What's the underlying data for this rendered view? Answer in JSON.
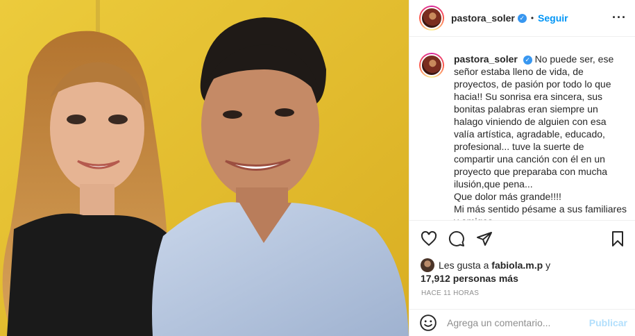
{
  "post": {
    "username": "pastora_soler",
    "separator": "•",
    "follow_label": "Seguir",
    "more_icon": "more-horizontal-icon",
    "verified_icon": "verified-badge-icon"
  },
  "caption": {
    "username": "pastora_soler",
    "text_line1": "No puede ser, ese señor estaba lleno de vida, de proyectos, de pasión por todo lo que hacia!! Su sonrisa era sincera, sus bonitas palabras eran siempre un halago viniendo de alguien con esa valía artística, agradable, educado, profesional... tuve la suerte de compartir una canción con él en un proyecto que preparaba con mucha ilusión,que pena...",
    "text_line2": "Que dolor más grande!!!!",
    "text_line3": "Mi más sentido pésame a sus familiares y amigos."
  },
  "actions": {
    "like_icon": "heart-icon",
    "comment_icon": "comment-icon",
    "share_icon": "share-icon",
    "save_icon": "bookmark-icon"
  },
  "likes": {
    "prefix": "Les gusta a",
    "first_user": "fabiola.m.p",
    "conjunction": "y",
    "count_text": "17,912 personas más"
  },
  "timestamp": "HACE 11 HORAS",
  "add_comment": {
    "placeholder": "Agrega un comentario...",
    "publish_label": "Publicar",
    "emoji_icon": "emoji-icon"
  },
  "colors": {
    "accent": "#0095f6",
    "publish_disabled": "#b2dffc",
    "photo_background": "#e8c230"
  }
}
